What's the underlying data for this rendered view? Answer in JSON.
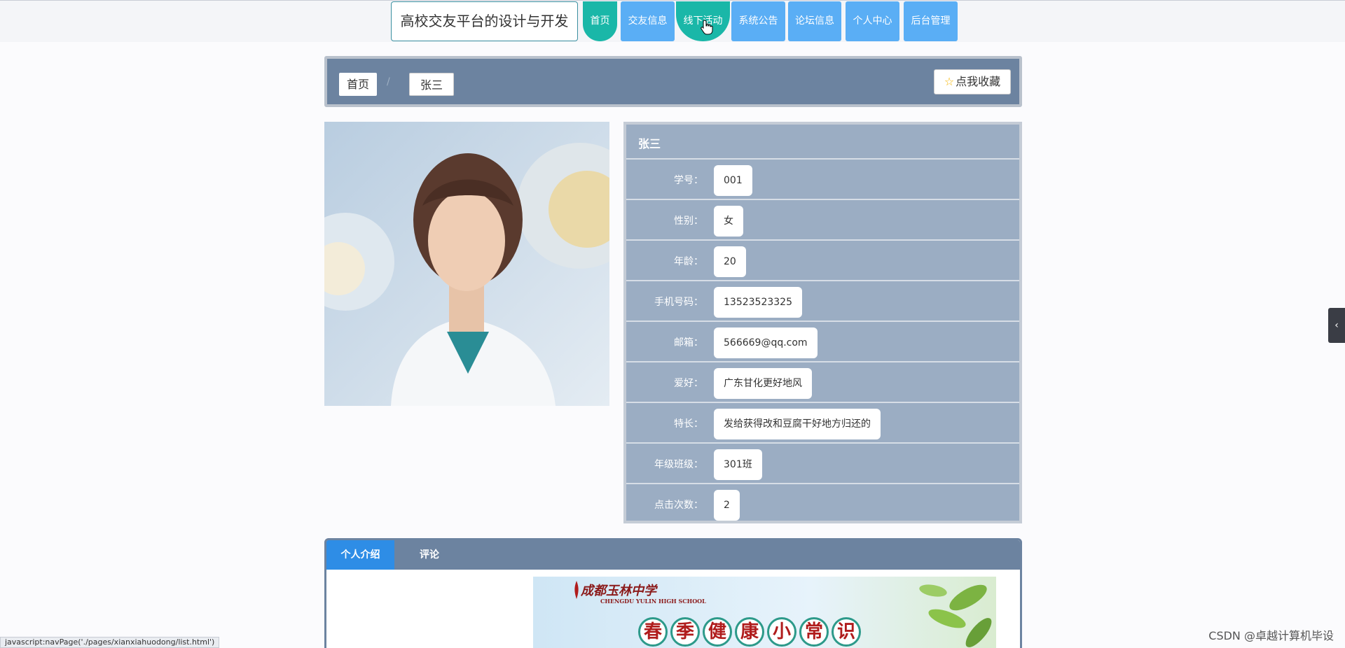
{
  "header": {
    "site_title": "高校交友平台的设计与开发",
    "nav": [
      {
        "label": "首页"
      },
      {
        "label": "交友信息"
      },
      {
        "label": "线下活动"
      },
      {
        "label": "系统公告"
      },
      {
        "label": "论坛信息"
      },
      {
        "label": "个人中心"
      },
      {
        "label": "后台管理"
      }
    ]
  },
  "breadcrumb": {
    "home": "首页",
    "separator": "/",
    "current": "张三",
    "favorite_label": "点我收藏"
  },
  "profile": {
    "name": "张三",
    "fields": [
      {
        "label": "学号：",
        "value": "001"
      },
      {
        "label": "性别：",
        "value": "女"
      },
      {
        "label": "年龄：",
        "value": "20"
      },
      {
        "label": "手机号码：",
        "value": "13523523325"
      },
      {
        "label": "邮箱：",
        "value": "566669@qq.com"
      },
      {
        "label": "爱好：",
        "value": "广东甘化更好地风"
      },
      {
        "label": "特长：",
        "value": "发给获得改和豆腐干好地方归还的"
      },
      {
        "label": "年级班级：",
        "value": "301班"
      },
      {
        "label": "点击次数：",
        "value": "2"
      }
    ]
  },
  "tabs": [
    {
      "label": "个人介绍"
    },
    {
      "label": "评论"
    }
  ],
  "banner": {
    "school_cn": "成都玉林中学",
    "school_en": "CHENGDU YULIN HIGH SCHOOL",
    "title_chars": [
      "春",
      "季",
      "健",
      "康",
      "小",
      "常",
      "识"
    ]
  },
  "status_bar": "javascript:navPage('./pages/xianxiahuodong/list.html')",
  "watermark": "CSDN @卓越计算机毕设",
  "side_toggle": "‹",
  "colors": {
    "nav_blue": "#5aaef5",
    "nav_active": "#1ab7a8",
    "panel": "#6c83a0",
    "info_panel": "#9badc3",
    "tab_active": "#2e8de6"
  }
}
